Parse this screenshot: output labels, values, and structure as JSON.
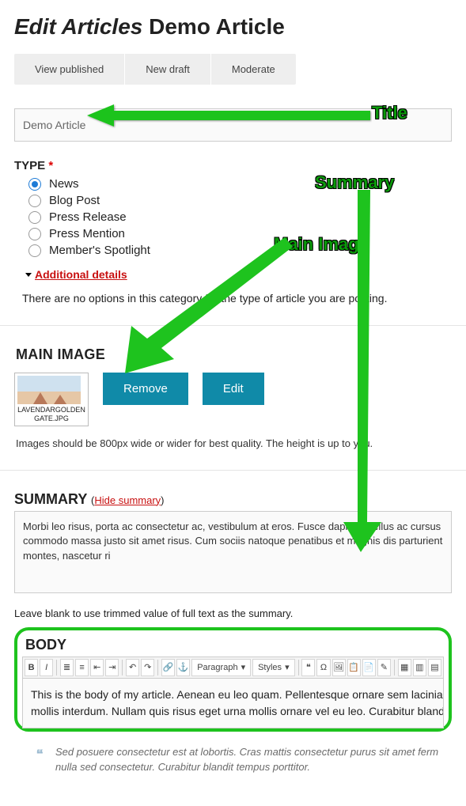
{
  "header": {
    "prefix": "Edit Articles",
    "title": "Demo Article"
  },
  "tabs": {
    "view": "View published",
    "draft": "New draft",
    "moderate": "Moderate"
  },
  "title_field": {
    "value": "Demo Article"
  },
  "type": {
    "label": "TYPE",
    "required": "*",
    "options": [
      "News",
      "Blog Post",
      "Press Release",
      "Press Mention",
      "Member's Spotlight"
    ],
    "selected_index": 0
  },
  "additional_details": {
    "link": "Additional details"
  },
  "no_options_msg": "There are no options in this category for the type of article you are posting.",
  "main_image": {
    "heading": "MAIN IMAGE",
    "filename": "LAVENDARGOLDENGATE.JPG",
    "remove": "Remove",
    "edit": "Edit",
    "hint": "Images should be 800px wide or wider for best quality. The height is up to you."
  },
  "summary": {
    "heading": "SUMMARY",
    "hide_label": "Hide summary",
    "text": "Morbi leo risus, porta ac consectetur ac, vestibulum at eros. Fusce dapibus, tellus ac cursus commodo massa justo sit amet risus. Cum sociis natoque penatibus et magnis dis parturient montes, nascetur ri",
    "leave_blank": "Leave blank to use trimmed value of full text as the summary."
  },
  "body": {
    "heading": "BODY",
    "toolbar": {
      "paragraph": "Paragraph",
      "styles": "Styles"
    },
    "line1": "This is the body of my article. Aenean eu leo quam. Pellentesque ornare sem lacinia quam",
    "line2": "mollis interdum. Nullam quis risus eget urna mollis ornare vel eu leo. Curabitur blandit tem",
    "quote": "Sed posuere consectetur est at lobortis. Cras mattis consectetur purus sit amet ferm nulla sed consectetur. Curabitur blandit tempus porttitor."
  },
  "callouts": {
    "title": "Title",
    "summary": "Summary",
    "main_image": "Main Image"
  }
}
